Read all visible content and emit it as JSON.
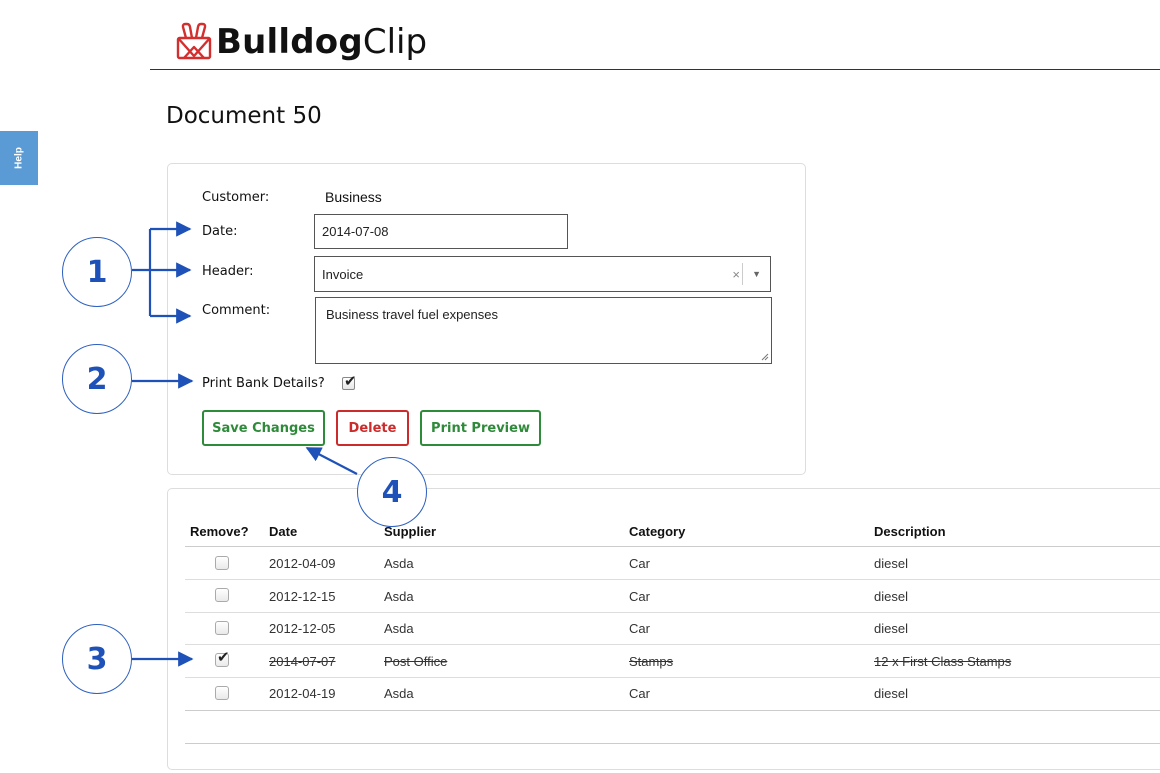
{
  "brand": {
    "bold": "Bulldog",
    "light": "Clip",
    "logo_icon": "binder-clip-icon",
    "color": "#d32f2f"
  },
  "help_tab": {
    "label": "Help"
  },
  "page": {
    "title": "Document 50"
  },
  "form": {
    "customer": {
      "label": "Customer:",
      "value": "Business"
    },
    "date": {
      "label": "Date:",
      "value": "2014-07-08"
    },
    "header": {
      "label": "Header:",
      "value": "Invoice",
      "clear": "×",
      "arrow": "▼"
    },
    "comment": {
      "label": "Comment:",
      "value": "Business travel fuel expenses"
    },
    "print_bank": {
      "label": "Print Bank Details?",
      "checked": true
    },
    "buttons": {
      "save": "Save Changes",
      "delete": "Delete",
      "preview": "Print Preview"
    }
  },
  "table": {
    "headers": [
      "Remove?",
      "Date",
      "Supplier",
      "Category",
      "Description"
    ],
    "rows": [
      {
        "remove": false,
        "date": "2012-04-09",
        "supplier": "Asda",
        "category": "Car",
        "description": "diesel"
      },
      {
        "remove": false,
        "date": "2012-12-15",
        "supplier": "Asda",
        "category": "Car",
        "description": "diesel"
      },
      {
        "remove": false,
        "date": "2012-12-05",
        "supplier": "Asda",
        "category": "Car",
        "description": "diesel"
      },
      {
        "remove": true,
        "date": "2014-07-07",
        "supplier": "Post Office",
        "category": "Stamps",
        "description": "12 x First Class Stamps"
      },
      {
        "remove": false,
        "date": "2012-04-19",
        "supplier": "Asda",
        "category": "Car",
        "description": "diesel"
      }
    ]
  },
  "annotations": {
    "c1": "1",
    "c2": "2",
    "c3": "3",
    "c4": "4",
    "color": "#1f52b8"
  }
}
